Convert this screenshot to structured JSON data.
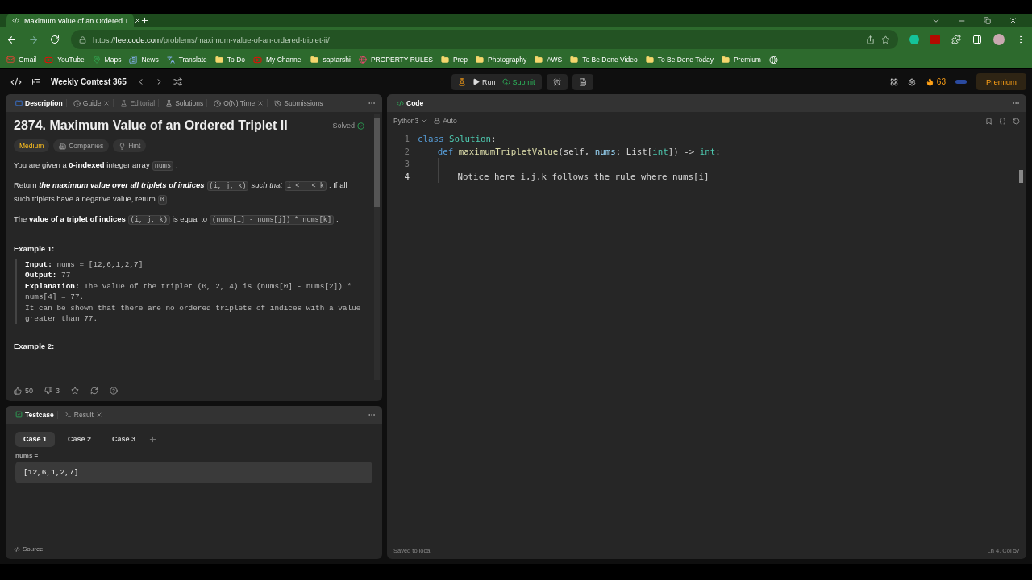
{
  "browser": {
    "tab_title": "Maximum Value of an Ordered T",
    "url": {
      "scheme": "https://",
      "host": "leetcode.com",
      "path": "/problems/maximum-value-of-an-ordered-triplet-ii/"
    },
    "bookmarks": [
      {
        "label": "Gmail",
        "kind": "mail"
      },
      {
        "label": "YouTube",
        "kind": "video"
      },
      {
        "label": "Maps",
        "kind": "map"
      },
      {
        "label": "News",
        "kind": "news"
      },
      {
        "label": "Translate",
        "kind": "translate"
      },
      {
        "label": "To Do",
        "kind": "folder"
      },
      {
        "label": "My Channel",
        "kind": "video"
      },
      {
        "label": "saptarshi",
        "kind": "folder"
      },
      {
        "label": "PROPERTY RULES",
        "kind": "site"
      },
      {
        "label": "Prep",
        "kind": "folder"
      },
      {
        "label": "Photography",
        "kind": "folder"
      },
      {
        "label": "AWS",
        "kind": "folder"
      },
      {
        "label": "To Be Done Video",
        "kind": "folder"
      },
      {
        "label": "To Be Done Today",
        "kind": "folder"
      },
      {
        "label": "Premium",
        "kind": "folder"
      }
    ]
  },
  "nav": {
    "title": "Weekly Contest 365",
    "run": "Run",
    "submit": "Submit",
    "streak": "63",
    "premium": "Premium"
  },
  "left_tabs": [
    {
      "label": "Description",
      "selected": true,
      "closable": false,
      "disabled": false
    },
    {
      "label": "Guide",
      "selected": false,
      "closable": true,
      "disabled": false
    },
    {
      "label": "Editorial",
      "selected": false,
      "closable": false,
      "disabled": true
    },
    {
      "label": "Solutions",
      "selected": false,
      "closable": false,
      "disabled": false
    },
    {
      "label": "O(N) Time",
      "selected": false,
      "closable": true,
      "disabled": false
    },
    {
      "label": "Submissions",
      "selected": false,
      "closable": false,
      "disabled": false
    }
  ],
  "problem": {
    "title": "2874. Maximum Value of an Ordered Triplet II",
    "status": "Solved",
    "tags": [
      {
        "label": "Medium",
        "kind": "difficulty"
      },
      {
        "label": "Companies",
        "kind": "companies"
      },
      {
        "label": "Hint",
        "kind": "hint"
      }
    ],
    "paragraphs": [
      [
        {
          "kind": "text",
          "text": "You are given a "
        },
        {
          "kind": "bold",
          "text": "0-indexed"
        },
        {
          "kind": "text",
          "text": " integer array"
        },
        {
          "kind": "code",
          "text": "nums"
        },
        {
          "kind": "text",
          "text": "."
        }
      ],
      [
        {
          "kind": "text",
          "text": "Return "
        },
        {
          "kind": "bolditalic",
          "text": "the maximum value over all triplets of indices"
        },
        {
          "kind": "code",
          "text": "(i, j, k)"
        },
        {
          "kind": "italic",
          "text": "such that"
        },
        {
          "kind": "code",
          "text": "i < j < k"
        },
        {
          "kind": "text",
          "text": ". If all such triplets have a negative value, return"
        },
        {
          "kind": "code",
          "text": "0"
        },
        {
          "kind": "text",
          "text": "."
        }
      ],
      [
        {
          "kind": "text",
          "text": "The "
        },
        {
          "kind": "bold",
          "text": "value of a triplet of indices"
        },
        {
          "kind": "code",
          "text": "(i, j, k)"
        },
        {
          "kind": "text",
          "text": "is equal to"
        },
        {
          "kind": "code",
          "text": "(nums[i] - nums[j]) * nums[k]"
        },
        {
          "kind": "text",
          "text": "."
        }
      ]
    ],
    "examples": [
      {
        "title": "Example 1:",
        "lines": [
          {
            "label": "Input:",
            "text": "nums = [12,6,1,2,7]"
          },
          {
            "label": "Output:",
            "text": "77"
          },
          {
            "label": "Explanation:",
            "text": "The value of the triplet (0, 2, 4) is (nums[0] - nums[2]) * nums[4] = 77.\nIt can be shown that there are no ordered triplets of indices with a value greater than 77."
          }
        ]
      },
      {
        "title": "Example 2:"
      }
    ],
    "likes": "50",
    "dislikes": "3"
  },
  "testcase": {
    "tabs": [
      {
        "label": "Testcase",
        "selected": true,
        "closable": false
      },
      {
        "label": "Result",
        "selected": false,
        "closable": true
      }
    ],
    "cases": [
      {
        "label": "Case 1",
        "selected": true
      },
      {
        "label": "Case 2",
        "selected": false
      },
      {
        "label": "Case 3",
        "selected": false
      }
    ],
    "param_label": "nums =",
    "param_value": "[12,6,1,2,7]",
    "source": "Source"
  },
  "code": {
    "title": "Code",
    "language": "Python3",
    "mode": "Auto",
    "lines": [
      {
        "number": "1",
        "tokens": [
          {
            "kind": "keyword",
            "text": "class "
          },
          {
            "kind": "class",
            "text": "Solution"
          },
          {
            "kind": "plain",
            "text": ":"
          }
        ],
        "children": [
          {
            "number": "2",
            "tokens": [
              {
                "kind": "keyword",
                "text": "def "
              },
              {
                "kind": "func",
                "text": "maximumTripletValue"
              },
              {
                "kind": "plain",
                "text": "(self, "
              },
              {
                "kind": "param",
                "text": "nums"
              },
              {
                "kind": "plain",
                "text": ": List["
              },
              {
                "kind": "type",
                "text": "int"
              },
              {
                "kind": "plain",
                "text": "]) -> "
              },
              {
                "kind": "type",
                "text": "int"
              },
              {
                "kind": "plain",
                "text": ":"
              }
            ],
            "children": [
              {
                "number": "3"
              },
              {
                "number": "4",
                "tokens": [
                  {
                    "kind": "plain",
                    "text": "Notice here i,j,k follows the rule where nums[i]"
                  }
                ]
              }
            ]
          }
        ]
      }
    ],
    "status": "Saved to local",
    "position": "Ln 4, Col 57"
  }
}
